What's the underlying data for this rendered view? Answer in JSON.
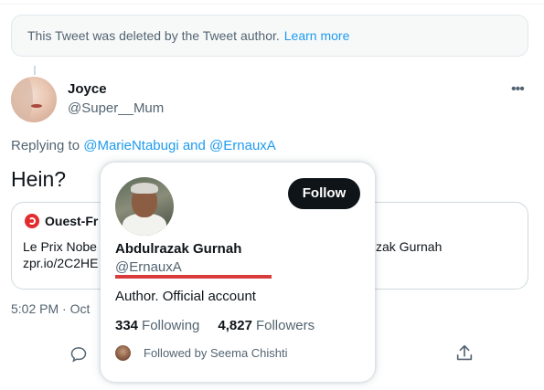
{
  "deleted_notice": {
    "text": "This Tweet was deleted by the Tweet author.",
    "link": "Learn more"
  },
  "tweet": {
    "author_name": "Joyce",
    "author_handle": "@Super__Mum",
    "replying_prefix": "Replying to",
    "mention1": "@MarieNtabugi",
    "and": "and",
    "mention2": "@ErnauxA",
    "text": "Hein?",
    "card": {
      "source": "Ouest-Fr",
      "line1_start": "Le Prix Nobe",
      "line1_end": "zak Gurnah",
      "line2": "zpr.io/2C2HE"
    },
    "timestamp": "5:02 PM · Oct"
  },
  "hovercard": {
    "name": "Abdulrazak Gurnah",
    "handle": "@ErnauxA",
    "follow_label": "Follow",
    "bio": "Author. Official account",
    "following_count": "334",
    "following_label": "Following",
    "followers_count": "4,827",
    "followers_label": "Followers",
    "followed_by": "Followed by Seema Chishti"
  },
  "colors": {
    "link": "#1d9bf0",
    "secondary_text": "#536471",
    "primary_text": "#0f1419",
    "highlight_underline": "#d93b3b"
  },
  "icons": [
    "more-icon",
    "reply-icon",
    "share-icon",
    "news-logo-icon"
  ]
}
